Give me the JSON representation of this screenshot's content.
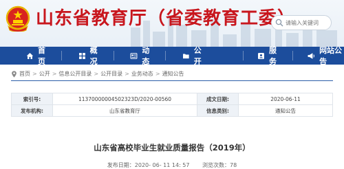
{
  "header": {
    "site_title": "山东省教育厅（省委教育工委）",
    "search_placeholder": "请输入关键词",
    "brand_red": "#c8161d"
  },
  "nav": {
    "items": [
      {
        "label": "首页",
        "icon": "home-icon"
      },
      {
        "label": "概况",
        "icon": "grid-icon"
      },
      {
        "label": "动态",
        "icon": "news-icon"
      },
      {
        "label": "公开",
        "icon": "folder-icon"
      },
      {
        "label": "服务",
        "icon": "service-icon"
      },
      {
        "label": "网站公告",
        "icon": "announcement-icon"
      }
    ],
    "color": "#1c4d9c"
  },
  "breadcrumb": {
    "items": [
      "首页",
      "公开",
      "信息公开目录",
      "公开目录",
      "业务动态",
      "通知公告"
    ]
  },
  "info": {
    "index_label": "索引号:",
    "index_value": "11370000004502323D/2020-00560",
    "date_label": "成文日期:",
    "date_value": "2020-06-11",
    "org_label": "发布机构:",
    "org_value": "山东省教育厅",
    "category_label": "信息类别:",
    "category_value": "通知公告"
  },
  "article": {
    "title": "山东省高校毕业生就业质量报告（2019年）",
    "publish_label": "发布日期：",
    "publish_time": "2020- 06- 11 14: 57",
    "views_label": "浏览次数：",
    "views_count": "78"
  }
}
